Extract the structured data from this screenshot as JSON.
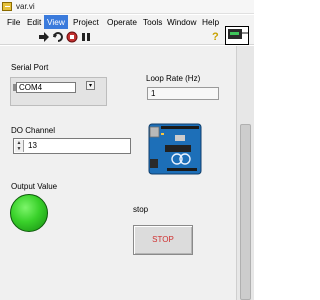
{
  "window": {
    "title": "var.vi"
  },
  "menu": {
    "items": [
      {
        "label": "File"
      },
      {
        "label": "Edit"
      },
      {
        "label": "View"
      },
      {
        "label": "Project"
      },
      {
        "label": "Operate"
      },
      {
        "label": "Tools"
      },
      {
        "label": "Window"
      },
      {
        "label": "Help"
      }
    ],
    "active_index": 2
  },
  "toolbar": {
    "icons": [
      "run-arrow-icon",
      "run-continuously-icon",
      "abort-icon",
      "pause-icon",
      "help-icon",
      "connector-pane-icon"
    ],
    "help_glyph": "?"
  },
  "controls": {
    "serial_port": {
      "label": "Serial Port",
      "value": "COM4"
    },
    "loop_rate": {
      "label": "Loop Rate (Hz)",
      "value": "1"
    },
    "do_channel": {
      "label": "DO Channel",
      "value": "13"
    },
    "output_value": {
      "label": "Output Value",
      "state": "on",
      "color": "#3ad12c"
    },
    "stop": {
      "label": "stop",
      "button_text": "STOP",
      "text_color": "#d03030"
    }
  },
  "colors": {
    "menu_highlight": "#3b7bdc",
    "panel_bg": "#f0f0f0",
    "board_blue": "#1d6fb8"
  }
}
